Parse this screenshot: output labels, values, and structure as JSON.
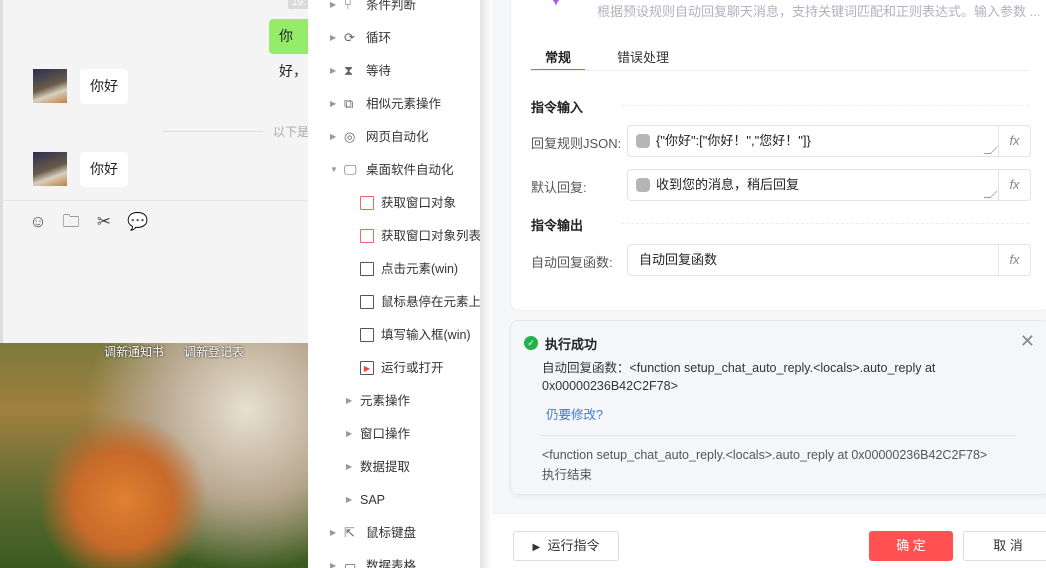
{
  "chat": {
    "timestamp": "19:",
    "my_message": "你好，",
    "messages": [
      "你好",
      "你好"
    ],
    "divider_text": "以下是新消息",
    "toolbar": [
      "emoji-icon",
      "folder-icon",
      "scissors-icon",
      "chat-icon"
    ]
  },
  "desktop": {
    "icons": [
      "调新通知书",
      "调新登记表"
    ]
  },
  "tree": {
    "items": [
      {
        "label": "条件判断",
        "icon": "branch-icon"
      },
      {
        "label": "循环",
        "icon": "loop-icon"
      },
      {
        "label": "等待",
        "icon": "hourglass-icon"
      },
      {
        "label": "相似元素操作",
        "icon": "copy-icon"
      },
      {
        "label": "网页自动化",
        "icon": "chrome-icon"
      },
      {
        "label": "桌面软件自动化",
        "icon": "monitor-icon"
      }
    ],
    "sub_items": [
      "获取窗口对象",
      "获取窗口对象列表",
      "点击元素(win)",
      "鼠标悬停在元素上(",
      "填写输入框(win)",
      "运行或打开"
    ],
    "groups": [
      "元素操作",
      "窗口操作",
      "数据提取",
      "SAP"
    ],
    "more": [
      {
        "label": "鼠标键盘"
      },
      {
        "label": "数据表格"
      }
    ]
  },
  "panel": {
    "description": "根据预设规则自动回复聊天消息，支持关键词匹配和正则表达式。输入参数 ...",
    "tabs": [
      "常规",
      "错误处理"
    ],
    "input_section": "指令输入",
    "output_section": "指令输出",
    "fields": {
      "rules_label": "回复规则JSON:",
      "rules_value": "{\"你好\":[\"你好！\",\"您好！\"]}",
      "default_label": "默认回复:",
      "default_value": "收到您的消息，稍后回复",
      "func_label": "自动回复函数:",
      "func_value": "自动回复函数",
      "fx": "fx"
    },
    "result": {
      "title": "执行成功",
      "text": "自动回复函数：<function setup_chat_auto_reply.<locals>.auto_reply at 0x00000236B42C2F78>",
      "link": "仍要修改?",
      "output": "<function setup_chat_auto_reply.<locals>.auto_reply at 0x00000236B42C2F78>",
      "end": "执行结束"
    },
    "buttons": {
      "run": "运行指令",
      "ok": "确 定",
      "cancel": "取 消"
    },
    "accent": "#f25252"
  }
}
